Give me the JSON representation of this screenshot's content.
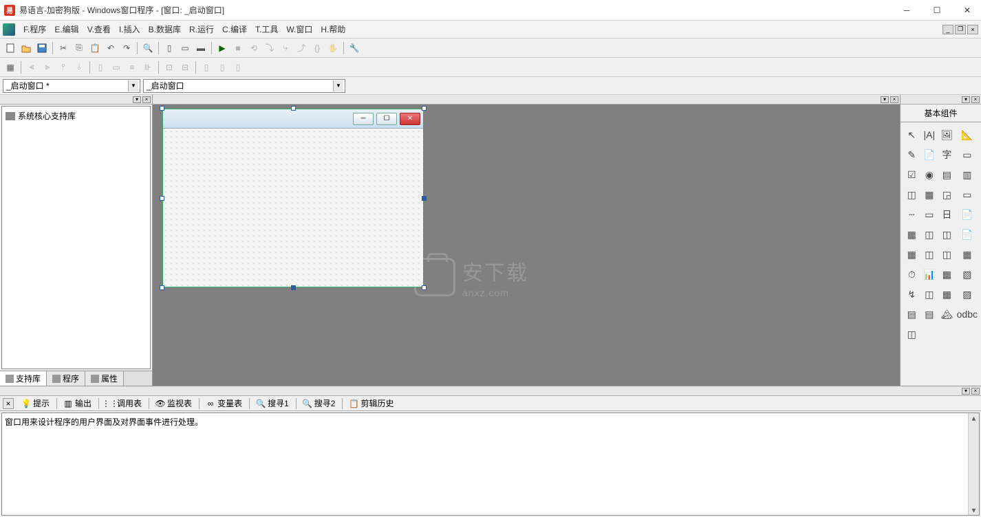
{
  "titlebar": {
    "app": "易语言-加密狗版",
    "sub": "Windows窗口程序",
    "doc": "[窗口: _启动窗口]"
  },
  "menu": {
    "items": [
      "F.程序",
      "E.编辑",
      "V.查看",
      "I.插入",
      "B.数据库",
      "R.运行",
      "C.编译",
      "T.工具",
      "W.窗口",
      "H.帮助"
    ]
  },
  "combos": {
    "left": "_启动窗口 *",
    "right": "_启动窗口"
  },
  "left": {
    "tree_root": "系统核心支持库",
    "tabs": [
      "支持库",
      "程序",
      "属性"
    ]
  },
  "right": {
    "title": "基本组件",
    "items": [
      "↖",
      "|A|",
      "🖼",
      "📐",
      "✎",
      "📄",
      "字",
      "▭",
      "☑",
      "◉",
      "▤",
      "▥",
      "◫",
      "▦",
      "◲",
      "▭",
      "┄",
      "▭",
      "日",
      "📄",
      "▦",
      "◫",
      "◫",
      "📄",
      "▦",
      "◫",
      "◫",
      "▦",
      "⏱",
      "📊",
      "▦",
      "▧",
      "↯",
      "◫",
      "▦",
      "▨",
      "▤",
      "▤",
      "🏔",
      "odbc",
      "◫",
      " ",
      " ",
      " "
    ]
  },
  "bottom": {
    "tabs": [
      "提示",
      "输出",
      "调用表",
      "监视表",
      "变量表",
      "搜寻1",
      "搜寻2",
      "剪辑历史"
    ],
    "hint": "窗口用来设计程序的用户界面及对界面事件进行处理。"
  },
  "watermark": {
    "main": "安下载",
    "sub": "anxz.com"
  }
}
